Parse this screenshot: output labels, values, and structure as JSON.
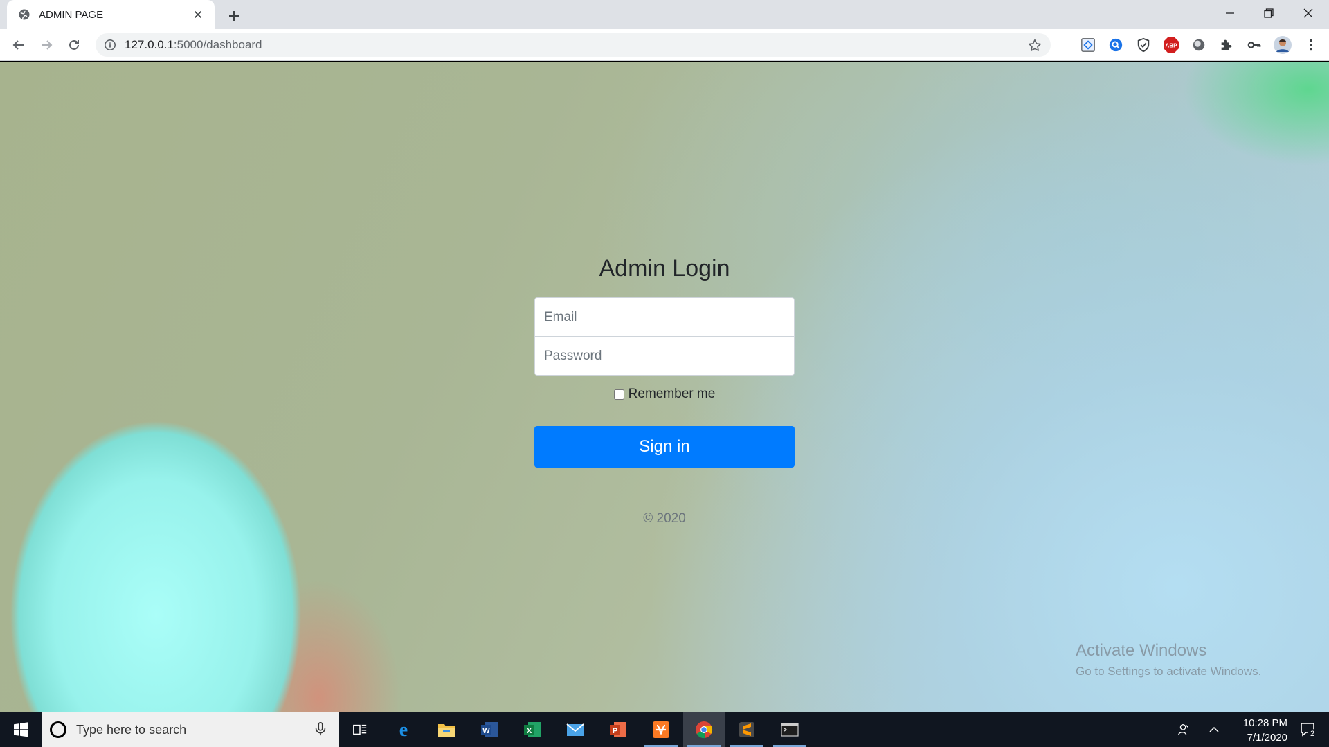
{
  "browser": {
    "tab_title": "ADMIN PAGE",
    "url_host": "127.0.0.1",
    "url_path": ":5000/dashboard"
  },
  "login": {
    "heading": "Admin Login",
    "email_placeholder": "Email",
    "password_placeholder": "Password",
    "remember_label": "Remember me",
    "remember_checked": false,
    "signin_label": "Sign in",
    "copyright": "© 2020"
  },
  "watermark": {
    "title": "Activate Windows",
    "subtitle": "Go to Settings to activate Windows."
  },
  "taskbar": {
    "search_placeholder": "Type here to search",
    "time": "10:28 PM",
    "date": "7/1/2020",
    "notification_count": "2"
  },
  "colors": {
    "primary_button": "#007bff",
    "taskbar": "#101620"
  },
  "icons": {
    "extensions": [
      "cast-icon",
      "search-extension-icon",
      "shield-extension-icon",
      "adblock-icon",
      "circle-extension-icon",
      "puzzle-icon",
      "key-icon",
      "profile-avatar"
    ],
    "taskbar_apps": [
      "task-view-icon",
      "edge-icon",
      "file-explorer-icon",
      "word-icon",
      "excel-icon",
      "mail-icon",
      "powerpoint-icon",
      "xampp-icon",
      "chrome-icon",
      "sublime-icon",
      "terminal-icon"
    ]
  }
}
